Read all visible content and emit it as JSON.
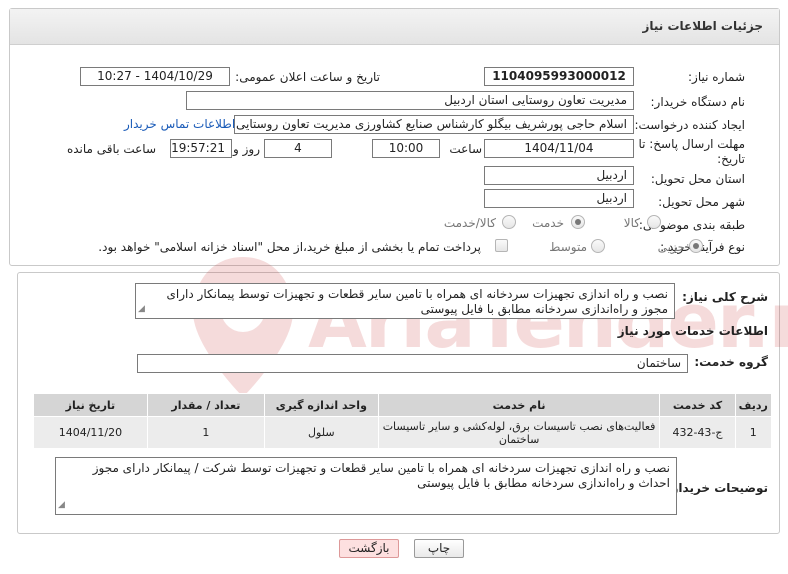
{
  "header": {
    "title": "جزئیات اطلاعات نیاز"
  },
  "form": {
    "need_number_label": "شماره نیاز:",
    "need_number": "1104095993000012",
    "announce_label": "تاریخ و ساعت اعلان عمومی:",
    "announce_value": "1404/10/29 - 10:27",
    "buyer_org_label": "نام دستگاه خریدار:",
    "buyer_org": "مدیریت تعاون روستایی  استان اردبیل",
    "creator_label": "ایجاد کننده درخواست:",
    "creator": "اسلام حاجی پورشریف بیگلو کارشناس صنایع کشاورزی مدیریت تعاون روستایی",
    "buyer_contact_link": "اطلاعات تماس خریدار",
    "deadline_label_1": "مهلت ارسال پاسخ: تا",
    "deadline_label_2": "تاریخ:",
    "deadline_date": "1404/11/04",
    "time_label": "ساعت",
    "deadline_time": "10:00",
    "days_value": "4",
    "days_label": "روز و",
    "remaining_time": "19:57:21",
    "remaining_label": "ساعت باقی مانده",
    "province_label": "استان محل تحویل:",
    "province": "اردبیل",
    "city_label": "شهر محل تحویل:",
    "city": "اردبیل",
    "category_label": "طبقه بندی موضوعی:",
    "category_options": [
      "کالا",
      "خدمت",
      "کالا/خدمت"
    ],
    "category_selected": "خدمت",
    "purchase_type_label": "نوع فرآیند خرید :",
    "purchase_options": [
      "جزیی",
      "متوسط"
    ],
    "purchase_selected": "جزیی",
    "payment_note": "پرداخت تمام یا بخشی از مبلغ خرید،از محل \"اسناد خزانه اسلامی\" خواهد بود."
  },
  "description": {
    "label": "شرح کلی نیاز:",
    "text": "نصب  و راه اندازی تجهیزات سردخانه ای همراه با تامین سایر قطعات و تجهیزات توسط پیمانکار  دارای مجوز و راه‌اندازی سردخانه مطابق با فایل پیوستی"
  },
  "services": {
    "section_title": "اطلاعات خدمات مورد نیاز",
    "group_label": "گروه خدمت:",
    "group_value": "ساختمان",
    "columns": [
      "ردیف",
      "کد خدمت",
      "نام خدمت",
      "واحد اندازه گیری",
      "تعداد / مقدار",
      "تاریخ نیاز"
    ],
    "rows": [
      {
        "row": "1",
        "code": "ج-43-432",
        "name": "فعالیت‌های نصب تاسیسات برق، لوله‌کشی و سایر تاسیسات ساختمان",
        "unit": "سلول",
        "qty": "1",
        "date": "1404/11/20"
      }
    ]
  },
  "buyer_notes": {
    "label": "توضیحات خریدار:",
    "text": "نصب  و راه اندازی تجهیزات سردخانه ای همراه با تامین سایر قطعات و تجهیزات توسط شرکت / پیمانکار  دارای مجوز احداث و راه‌اندازی سردخانه مطابق با فایل پیوستی"
  },
  "buttons": {
    "print": "چاپ",
    "back": "بازگشت"
  },
  "watermark": {
    "text": "AriaTender.net"
  },
  "colors": {
    "link": "#1a5bb8",
    "back_button": "#fde0e0",
    "table_header": "#d5d5d5",
    "watermark": "#c62828"
  }
}
